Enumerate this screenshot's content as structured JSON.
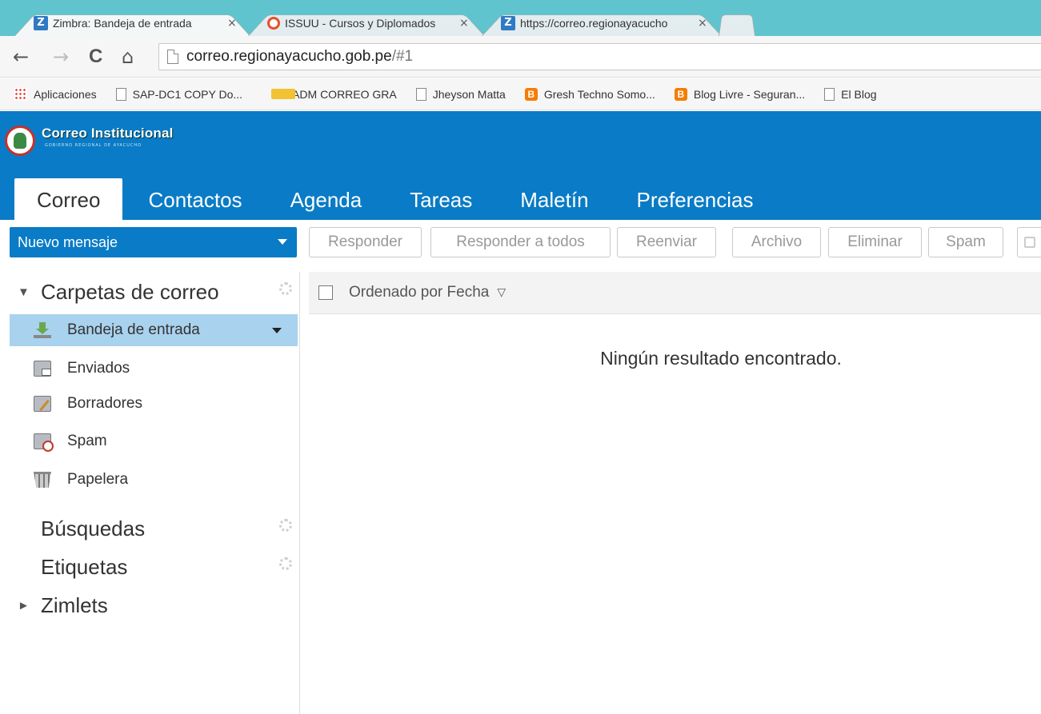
{
  "browser": {
    "tabs": [
      {
        "title": "Zimbra: Bandeja de entrada",
        "close": "×",
        "favicon": "Z"
      },
      {
        "title": "ISSUU - Cursos y Diplomados",
        "close": "×",
        "favicon": ""
      },
      {
        "title": "https://correo.regionayacucho",
        "close": "×",
        "favicon": "Z"
      }
    ],
    "nav": {
      "back": "←",
      "forward": "→",
      "reload": "C",
      "home": "⌂"
    },
    "url_host": "correo.regionayacucho.gob.pe",
    "url_path": "/#1",
    "bookmarks": [
      {
        "label": "Aplicaciones",
        "icon": "apps-icon"
      },
      {
        "label": "SAP-DC1 COPY Do...",
        "icon": "page-icon"
      },
      {
        "label": "ADM CORREO GRA",
        "icon": "folder-icon"
      },
      {
        "label": "Jheyson Matta",
        "icon": "page-icon"
      },
      {
        "label": "Gresh Techno Somo...",
        "icon": "blogger-icon"
      },
      {
        "label": "Blog Livre - Seguran...",
        "icon": "blogger-icon"
      },
      {
        "label": "El Blog",
        "icon": "page-icon"
      }
    ],
    "blogger_glyph": "B"
  },
  "app": {
    "logo_title": "Correo Institucional",
    "logo_subtitle": "GOBIERNO REGIONAL DE AYACUCHO",
    "tabs": [
      "Correo",
      "Contactos",
      "Agenda",
      "Tareas",
      "Maletín",
      "Preferencias"
    ],
    "colors": {
      "brand": "#0a7bc6",
      "selected": "#a9d2ee",
      "chrome": "#5fc4cd"
    }
  },
  "toolbar": {
    "new_message": "Nuevo mensaje",
    "buttons": [
      "Responder",
      "Responder a todos",
      "Reenviar",
      "Archivo",
      "Eliminar",
      "Spam"
    ]
  },
  "sidebar": {
    "mail_folders_title": "Carpetas de correo",
    "folders": [
      "Bandeja de entrada",
      "Enviados",
      "Borradores",
      "Spam",
      "Papelera"
    ],
    "searches_title": "Búsquedas",
    "tags_title": "Etiquetas",
    "zimlets_title": "Zimlets",
    "expanded_glyph": "▼",
    "collapsed_glyph": "►"
  },
  "list": {
    "sort_label": "Ordenado por Fecha",
    "sort_glyph": "▽",
    "empty_message": "Ningún resultado encontrado."
  }
}
